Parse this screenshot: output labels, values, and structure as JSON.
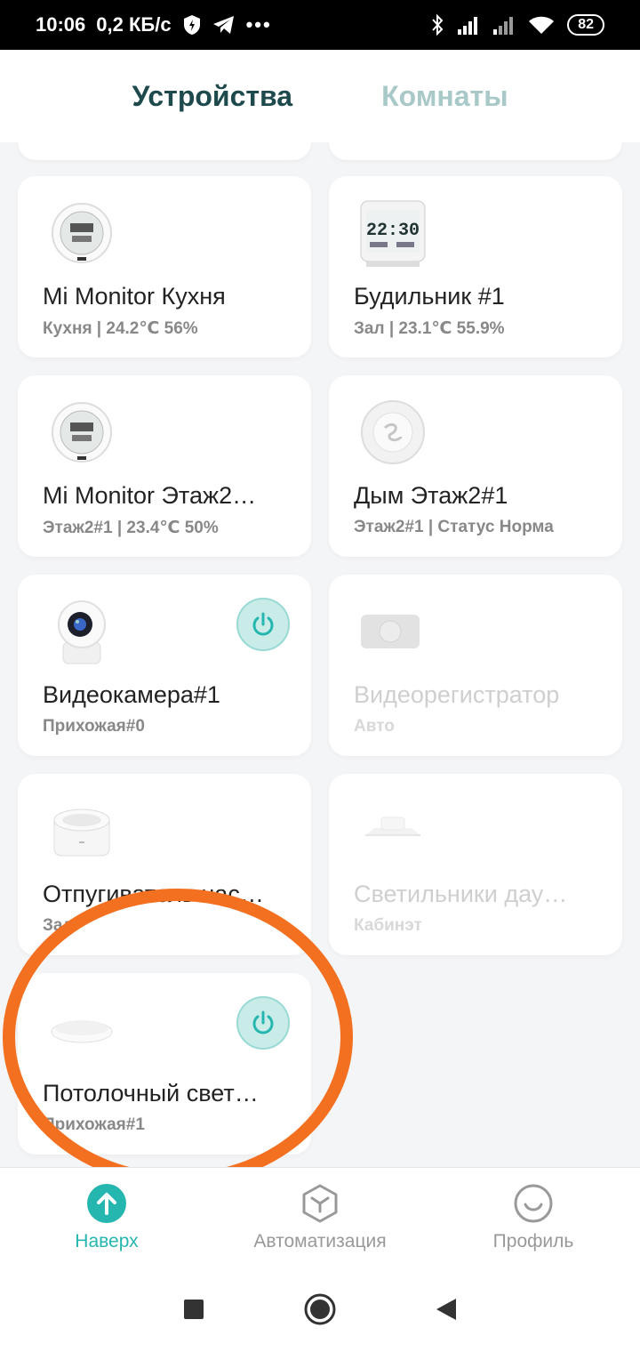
{
  "status_bar": {
    "time": "10:06",
    "speed": "0,2 КБ/с",
    "battery": "82"
  },
  "tabs": [
    {
      "label": "Устройства",
      "active": true
    },
    {
      "label": "Комнаты",
      "active": false
    }
  ],
  "devices": [
    {
      "name": "Mi Monitor Кухня",
      "sub": "Кухня | 24.2℃ 56%",
      "icon": "thermometer-hygrometer-icon",
      "enabled": true
    },
    {
      "name": "Будильник #1",
      "sub": "Зал | 23.1℃ 55.9%",
      "icon": "alarm-clock-icon",
      "enabled": true
    },
    {
      "name": "Mi Monitor Этаж2…",
      "sub": "Этаж2#1 | 23.4℃ 50%",
      "icon": "thermometer-hygrometer-icon",
      "enabled": true
    },
    {
      "name": "Дым Этаж2#1",
      "sub": "Этаж2#1 | Статус Норма",
      "icon": "smoke-detector-icon",
      "enabled": true
    },
    {
      "name": "Видеокамера#1",
      "sub": "Прихожая#0",
      "icon": "camera-icon",
      "enabled": true,
      "power": true
    },
    {
      "name": "Видеорегистратор",
      "sub": "Авто",
      "icon": "dashcam-icon",
      "enabled": false
    },
    {
      "name": "Отпугиватель нас…",
      "sub": "Зал",
      "icon": "repeller-icon",
      "enabled": true
    },
    {
      "name": "Светильники дау…",
      "sub": "Кабинэт",
      "icon": "downlight-icon",
      "enabled": false
    },
    {
      "name": "Потолочный свет…",
      "sub": "Прихожая#1",
      "icon": "ceiling-light-icon",
      "enabled": true,
      "power": true
    }
  ],
  "bottom_nav": [
    {
      "label": "Наверх",
      "icon": "arrow-up-icon",
      "active": true
    },
    {
      "label": "Автоматизация",
      "icon": "automation-icon",
      "active": false
    },
    {
      "label": "Профиль",
      "icon": "profile-icon",
      "active": false
    }
  ],
  "colors": {
    "accent": "#26b6b0",
    "annotation": "#f37021",
    "tab_active": "#1e4a4d",
    "tab_inactive": "#a9c9c9"
  }
}
